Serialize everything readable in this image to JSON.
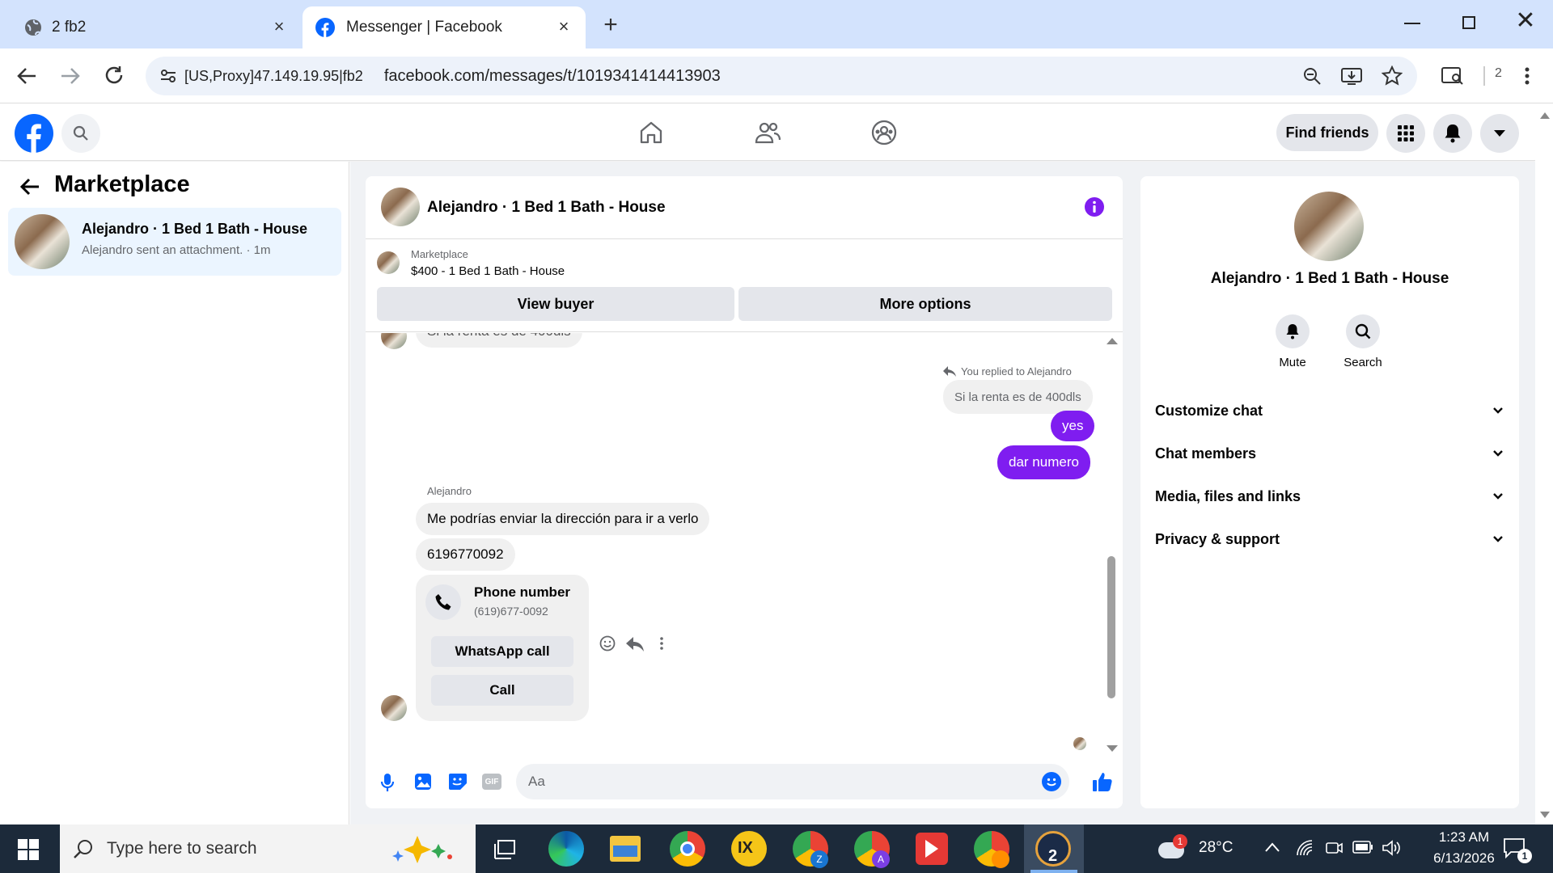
{
  "browser": {
    "tabs": [
      {
        "title": "2 fb2",
        "active": false
      },
      {
        "title": "Messenger | Facebook",
        "active": true
      }
    ],
    "proxy_chip": "[US,Proxy]47.149.19.95|fb2",
    "url": "facebook.com/messages/t/1019341414413903",
    "profile_count": "2"
  },
  "fb_header": {
    "find_friends": "Find friends"
  },
  "left_panel": {
    "title": "Marketplace",
    "conversation": {
      "name": "Alejandro · 1 Bed 1 Bath - House",
      "preview": "Alejandro sent an attachment. · 1m"
    }
  },
  "chat": {
    "header_title": "Alejandro · 1 Bed 1 Bath - House",
    "listing": {
      "source": "Marketplace",
      "title": "$400 - 1 Bed 1 Bath - House",
      "view_buyer": "View buyer",
      "more_options": "More options"
    },
    "messages": {
      "partial_top": "Si la renta es de 400dls",
      "reply_label": "You replied to Alejandro",
      "reply_quote": "Si la renta es de 400dls",
      "sent_1": "yes",
      "sent_2": "dar numero",
      "sender_name": "Alejandro",
      "recv_1": "Me podrías enviar la dirección para ir a verlo",
      "recv_2": "6196770092"
    },
    "phone_card": {
      "title": "Phone number",
      "number": "(619)677-0092",
      "whatsapp": "WhatsApp call",
      "call": "Call"
    },
    "composer_placeholder": "Aa",
    "accent_color": "#7f1df0",
    "messenger_blue": "#0866ff"
  },
  "right_panel": {
    "name": "Alejandro · 1 Bed 1 Bath - House",
    "mute": "Mute",
    "search": "Search",
    "sections": [
      "Customize chat",
      "Chat members",
      "Media, files and links",
      "Privacy & support"
    ]
  },
  "taskbar": {
    "search_placeholder": "Type here to search",
    "weather": "28°C",
    "weather_badge": "1",
    "time": "1:23 AM",
    "date": "6/13/2026",
    "notif_count": "1",
    "active_app_badge": "2"
  }
}
